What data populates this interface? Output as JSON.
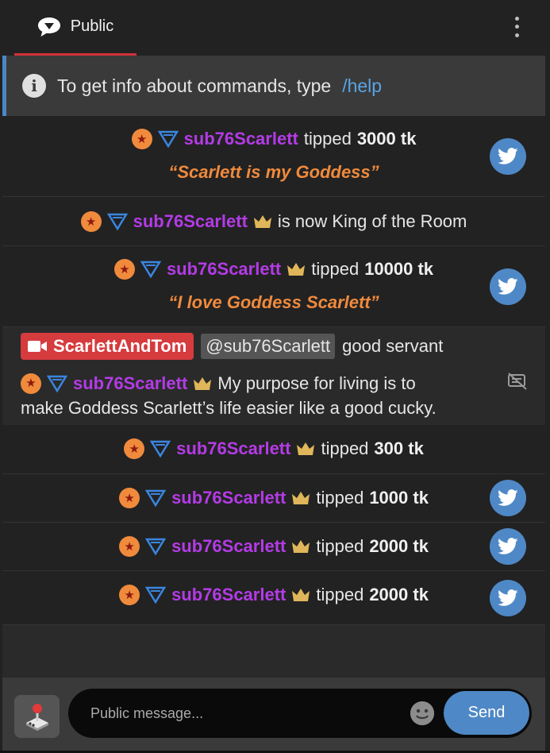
{
  "header": {
    "tab_label": "Public"
  },
  "info": {
    "text": "To get info about commands, type",
    "link": "/help"
  },
  "badge_star_glyph": "★",
  "colors": {
    "accent_red": "#d0303a",
    "username": "#b43be6",
    "quote": "#f08a3c",
    "twitter": "#4f88c6",
    "crown": "#e0b65a"
  },
  "messages": [
    {
      "type": "tip",
      "username": "sub76Scarlett",
      "verb": "tipped",
      "amount": "3000 tk",
      "quote": "“Scarlett is my Goddess”",
      "crown": false,
      "twitter": true
    },
    {
      "type": "king",
      "username": "sub76Scarlett",
      "text": "is now King of the Room",
      "crown": true
    },
    {
      "type": "tip",
      "username": "sub76Scarlett",
      "verb": "tipped",
      "amount": "10000 tk",
      "quote": "“I love Goddess Scarlett”",
      "crown": true,
      "twitter": true
    },
    {
      "type": "broadcaster",
      "username": "ScarlettAndTom",
      "mention": "@sub76Scarlett",
      "text": "good servant"
    },
    {
      "type": "chat",
      "username": "sub76Scarlett",
      "text_line1": "My purpose for living is to",
      "text_line2": "make Goddess Scarlett’s life easier like a good cucky."
    },
    {
      "type": "tip",
      "username": "sub76Scarlett",
      "verb": "tipped",
      "amount": "300 tk",
      "crown": true,
      "twitter": false
    },
    {
      "type": "tip",
      "username": "sub76Scarlett",
      "verb": "tipped",
      "amount": "1000 tk",
      "crown": true,
      "twitter": true
    },
    {
      "type": "tip",
      "username": "sub76Scarlett",
      "verb": "tipped",
      "amount": "2000 tk",
      "crown": true,
      "twitter": true
    },
    {
      "type": "tip",
      "username": "sub76Scarlett",
      "verb": "tipped",
      "amount": "2000 tk",
      "crown": true,
      "twitter": true
    }
  ],
  "footer": {
    "placeholder": "Public message...",
    "send_label": "Send"
  },
  "icons": [
    "chat-bubble-icon",
    "kebab-menu-icon",
    "info-icon",
    "star-badge-icon",
    "triangle-badge-icon",
    "crown-icon",
    "twitter-icon",
    "camera-icon",
    "mute-icon",
    "joystick-icon",
    "emoji-icon"
  ]
}
